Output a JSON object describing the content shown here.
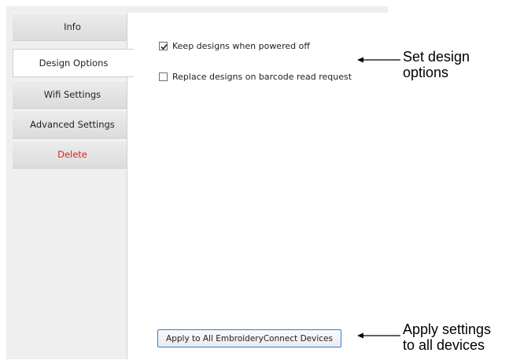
{
  "sidebar": {
    "tabs": [
      {
        "label": "Info"
      },
      {
        "label": "Design Options"
      },
      {
        "label": "Wifi Settings"
      },
      {
        "label": "Advanced Settings"
      },
      {
        "label": "Delete"
      }
    ],
    "active_tab": "Design Options"
  },
  "design_options": {
    "keep_designs": {
      "label": "Keep designs when powered off",
      "checked": true
    },
    "replace_designs": {
      "label": "Replace designs on barcode read request",
      "checked": false
    }
  },
  "apply_button": {
    "label": "Apply to All EmbroideryConnect Devices"
  },
  "annotations": {
    "design_options": {
      "line1": "Set design",
      "line2": "options"
    },
    "apply_settings": {
      "line1": "Apply settings",
      "line2": "to all devices"
    }
  },
  "colors": {
    "delete_text": "#e02020",
    "button_border": "#2b7ce0",
    "panel_background": "#efefef"
  }
}
